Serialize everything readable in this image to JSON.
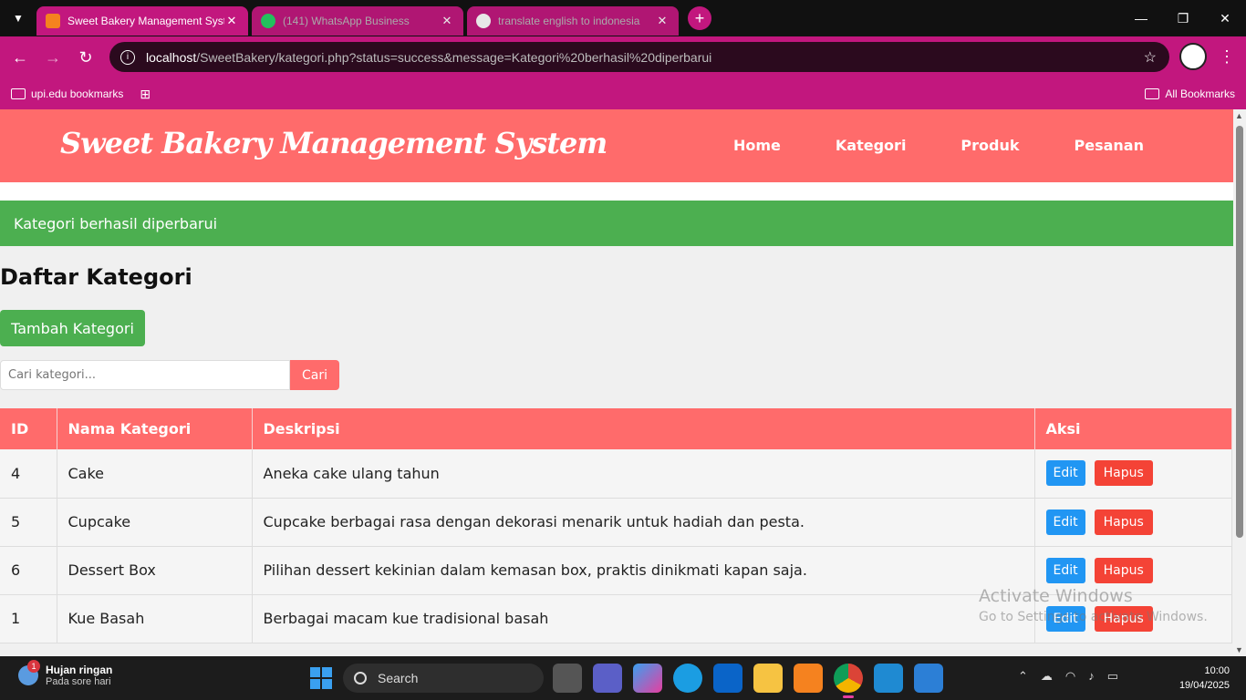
{
  "browser": {
    "tabs": [
      {
        "title": "Sweet Bakery Management System",
        "favicon_color": "#f5821f",
        "active": true
      },
      {
        "title": "(141) WhatsApp Business",
        "favicon_color": "#25d366",
        "active": false
      },
      {
        "title": "translate english to indonesia",
        "favicon_color": "#ffffff",
        "active": false
      }
    ],
    "url_host": "localhost",
    "url_path": "/SweetBakery/kategori.php?status=success&message=Kategori%20berhasil%20diperbarui",
    "bookmark_folder": "upi.edu bookmarks",
    "all_bookmarks": "All Bookmarks"
  },
  "site": {
    "brand": "Sweet Bakery Management System",
    "nav": [
      "Home",
      "Kategori",
      "Produk",
      "Pesanan"
    ],
    "alert": "Kategori berhasil diperbarui",
    "page_title": "Daftar Kategori",
    "add_button": "Tambah Kategori",
    "search_placeholder": "Cari kategori...",
    "search_button": "Cari",
    "colors": {
      "header": "#ff6b6b",
      "success": "#4caf50",
      "edit": "#2196f3",
      "delete": "#f44336"
    }
  },
  "table": {
    "headers": [
      "ID",
      "Nama Kategori",
      "Deskripsi",
      "Aksi"
    ],
    "edit_label": "Edit",
    "delete_label": "Hapus",
    "rows": [
      {
        "id": "4",
        "name": "Cake",
        "desc": "Aneka cake ulang tahun"
      },
      {
        "id": "5",
        "name": "Cupcake",
        "desc": "Cupcake berbagai rasa dengan dekorasi menarik untuk hadiah dan pesta."
      },
      {
        "id": "6",
        "name": "Dessert Box",
        "desc": "Pilihan dessert kekinian dalam kemasan box, praktis dinikmati kapan saja."
      },
      {
        "id": "1",
        "name": "Kue Basah",
        "desc": "Berbagai macam kue tradisional basah"
      }
    ]
  },
  "watermark": {
    "line1": "Activate Windows",
    "line2": "Go to Settings to activate Windows."
  },
  "taskbar": {
    "weather_title": "Hujan ringan",
    "weather_sub": "Pada sore hari",
    "weather_badge": "1",
    "search_label": "Search",
    "time": "10:00",
    "date": "19/04/2025"
  }
}
